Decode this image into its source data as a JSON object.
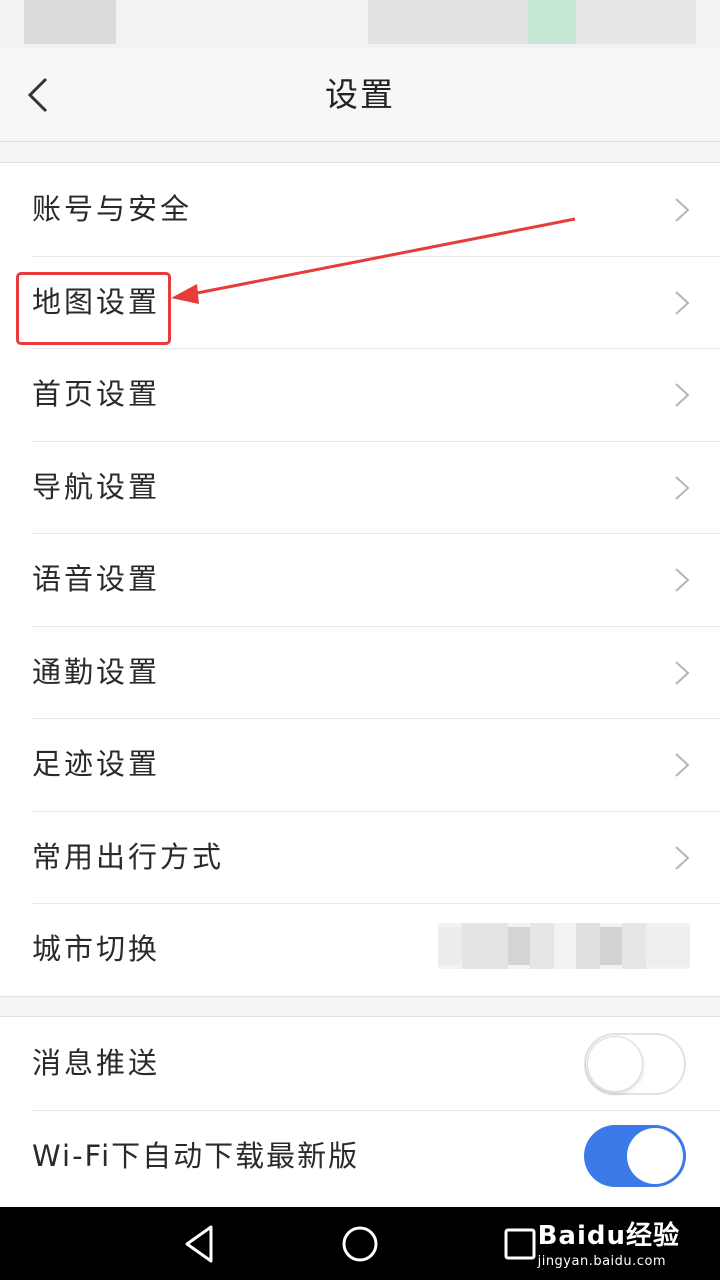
{
  "header": {
    "title": "设置"
  },
  "settings_group_1": {
    "items": [
      {
        "label": "账号与安全"
      },
      {
        "label": "地图设置"
      },
      {
        "label": "首页设置"
      },
      {
        "label": "导航设置"
      },
      {
        "label": "语音设置"
      },
      {
        "label": "通勤设置"
      },
      {
        "label": "足迹设置"
      },
      {
        "label": "常用出行方式"
      },
      {
        "label": "城市切换"
      }
    ]
  },
  "settings_group_2": {
    "push": {
      "label": "消息推送",
      "enabled": false
    },
    "wifi_update": {
      "label": "Wi-Fi下自动下载最新版",
      "enabled": true
    }
  },
  "watermark": {
    "logo": "Baidu经验",
    "url": "jingyan.baidu.com"
  },
  "colors": {
    "accent": "#3b7ae8",
    "annotation": "#e83b3b"
  }
}
